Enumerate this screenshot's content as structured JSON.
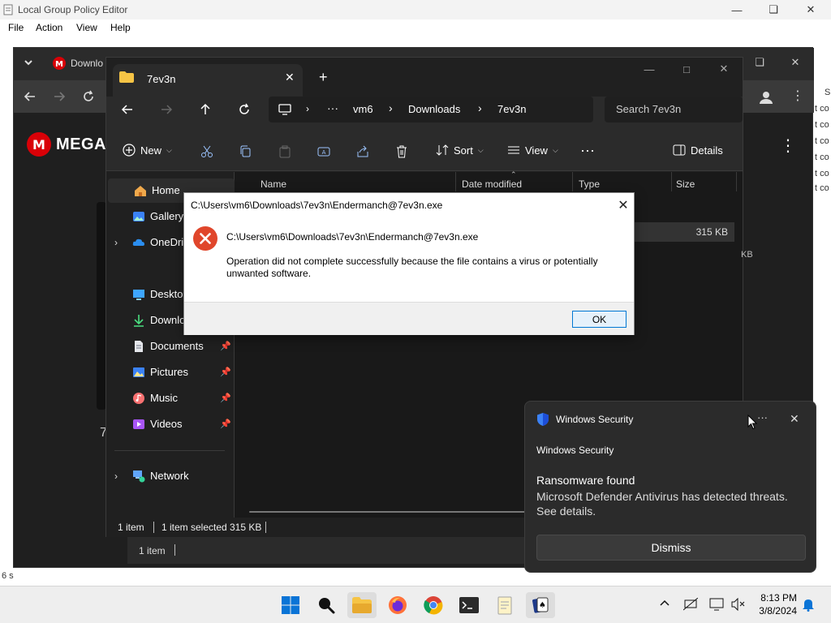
{
  "gp_editor": {
    "title": "Local Group Policy Editor",
    "menu": [
      "File",
      "Action",
      "View",
      "Help"
    ],
    "status_text": "6 s",
    "right_cells": [
      "S",
      "t co",
      "t co",
      "t co",
      "t co",
      "t co",
      "t co"
    ]
  },
  "browser": {
    "tab_label": "Downlo",
    "brand": "MEGA",
    "side_text": "7",
    "status_text": "1 item"
  },
  "explorer": {
    "tab_title": "7ev3n",
    "breadcrumb": [
      "vm6",
      "Downloads",
      "7ev3n"
    ],
    "search_placeholder": "Search 7ev3n",
    "toolbar": {
      "new_label": "New",
      "sort_label": "Sort",
      "view_label": "View",
      "details_label": "Details"
    },
    "nav_items": [
      {
        "label": "Home"
      },
      {
        "label": "Gallery"
      },
      {
        "label": "OneDrive"
      },
      {
        "label": "Desktop"
      },
      {
        "label": "Downloads"
      },
      {
        "label": "Documents"
      },
      {
        "label": "Pictures"
      },
      {
        "label": "Music"
      },
      {
        "label": "Videos"
      },
      {
        "label": "Network"
      }
    ],
    "columns": [
      "Name",
      "Date modified",
      "Type",
      "Size"
    ],
    "file_size": "315 KB",
    "file_size_behind": "KB",
    "status_count": "1 item",
    "status_selected": "1 item selected",
    "status_size": "315 KB"
  },
  "dialog": {
    "title": "C:\\Users\\vm6\\Downloads\\7ev3n\\Endermanch@7ev3n.exe",
    "path": "C:\\Users\\vm6\\Downloads\\7ev3n\\Endermanch@7ev3n.exe",
    "message_line1": "Operation did not complete successfully because the file contains a virus or potentially",
    "message_line2": "unwanted software.",
    "ok_label": "OK"
  },
  "toast": {
    "app_name": "Windows Security",
    "header": "Windows Security",
    "heading": "Ransomware found",
    "body_line1": "Microsoft Defender Antivirus has detected threats.",
    "body_line2": "See details.",
    "dismiss_label": "Dismiss",
    "more_label": "···"
  },
  "taskbar": {
    "time": "8:13 PM",
    "date": "3/8/2024"
  },
  "colors": {
    "accent": "#0078d4",
    "error_red": "#e0462b",
    "explorer_bg": "#202020",
    "toast_bg": "#2b2b2b",
    "mega_red": "#d90007"
  }
}
